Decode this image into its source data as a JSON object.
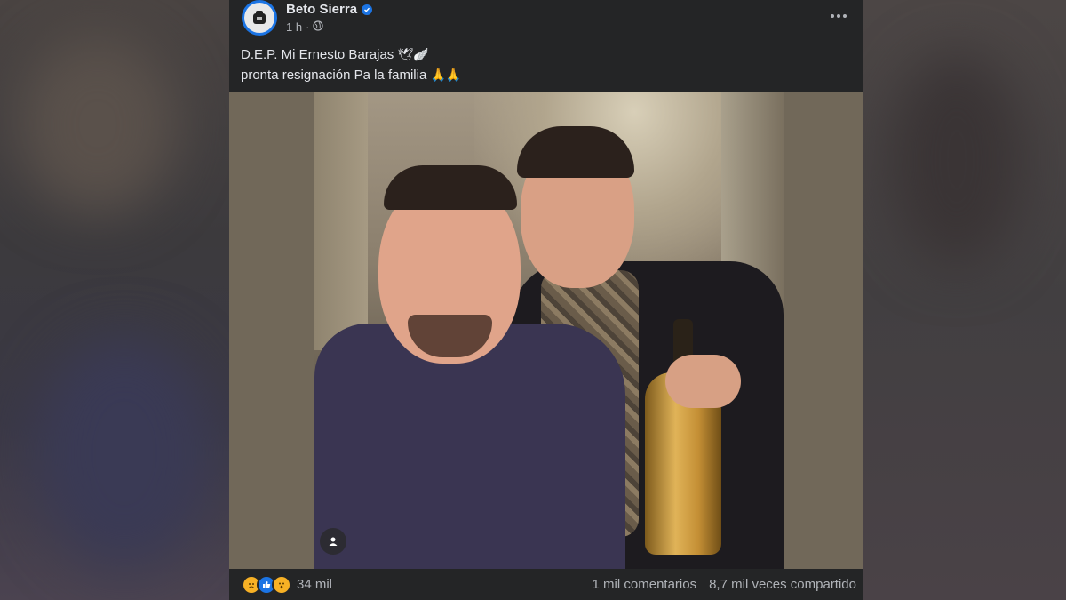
{
  "post": {
    "author": "Beto Sierra",
    "time": "1 h",
    "caption_line1": "D.E.P. Mi Ernesto Barajas",
    "caption_line1_emoji": "🕊🪽",
    "caption_line2": "pronta resignación Pa la familia",
    "caption_line2_emoji": "🙏🙏"
  },
  "footer": {
    "reactions": [
      "sad",
      "like",
      "wow"
    ],
    "reaction_count": "34 mil",
    "comments": "1 mil comentarios",
    "shares": "8,7 mil veces compartido"
  },
  "icons": {
    "verified": "verified-badge-icon",
    "audience": "globe-icon",
    "more": "more-options-icon",
    "photo_tag": "person-icon"
  },
  "colors": {
    "post_bg": "#242526",
    "verified_blue": "#1b74e4",
    "text_primary": "#e4e6eb",
    "text_secondary": "#b0b3b8"
  }
}
